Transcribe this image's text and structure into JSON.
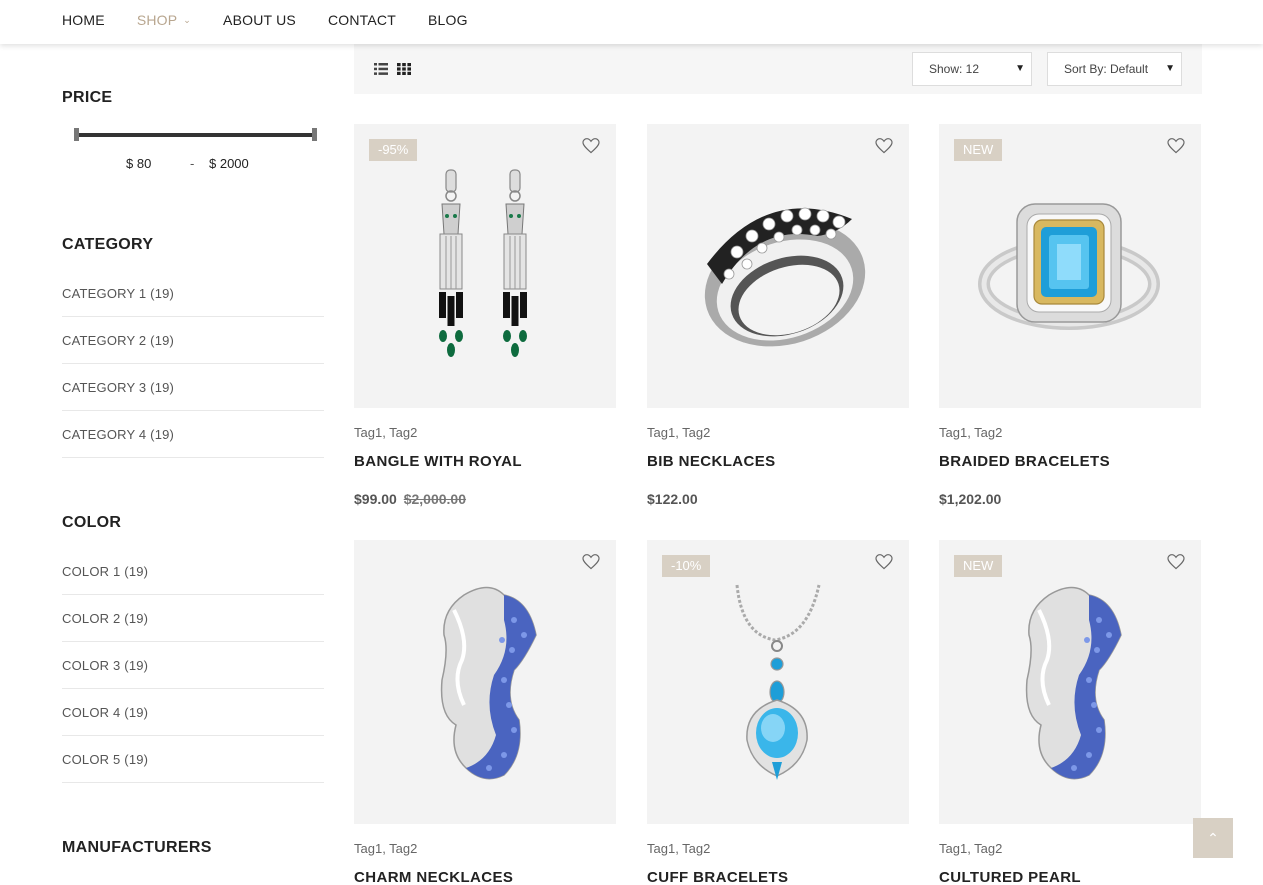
{
  "nav": {
    "items": [
      {
        "label": "HOME"
      },
      {
        "label": "SHOP"
      },
      {
        "label": "ABOUT US"
      },
      {
        "label": "CONTACT"
      },
      {
        "label": "BLOG"
      }
    ],
    "active": "SHOP",
    "accent": "#b8a68f"
  },
  "sidebar": {
    "price": {
      "title": "PRICE",
      "from": "$ 80",
      "separator": "-",
      "to": "$ 2000"
    },
    "category": {
      "title": "CATEGORY",
      "items": [
        "CATEGORY 1 (19)",
        "CATEGORY 2 (19)",
        "CATEGORY 3 (19)",
        "CATEGORY 4 (19)"
      ]
    },
    "color": {
      "title": "COLOR",
      "items": [
        "COLOR 1 (19)",
        "COLOR 2 (19)",
        "COLOR 3 (19)",
        "COLOR 4 (19)",
        "COLOR 5 (19)"
      ]
    },
    "manufacturers": {
      "title": "MANUFACTURERS"
    }
  },
  "toolbar": {
    "show": "Show: 12",
    "sort": "Sort By: Default"
  },
  "products": [
    {
      "badge": "-95%",
      "tags": "Tag1, Tag2",
      "name": "BANGLE WITH ROYAL",
      "price": "$99.00",
      "old_price": "$2,000.00",
      "image": "earrings"
    },
    {
      "badge": "",
      "tags": "Tag1, Tag2",
      "name": "BIB NECKLACES",
      "price": "$122.00",
      "old_price": "",
      "image": "ring"
    },
    {
      "badge": "NEW",
      "tags": "Tag1, Tag2",
      "name": "BRAIDED BRACELETS",
      "price": "$1,202.00",
      "old_price": "",
      "image": "topaz-ring"
    },
    {
      "badge": "",
      "tags": "Tag1, Tag2",
      "name": "CHARM NECKLACES",
      "price": "",
      "old_price": "",
      "image": "sapphire-ring"
    },
    {
      "badge": "-10%",
      "tags": "Tag1, Tag2",
      "name": "CUFF BRACELETS",
      "price": "",
      "old_price": "",
      "image": "pendant"
    },
    {
      "badge": "NEW",
      "tags": "Tag1, Tag2",
      "name": "CULTURED PEARL",
      "price": "",
      "old_price": "",
      "image": "sapphire-ring"
    }
  ],
  "colors": {
    "badge": "#d8d0c4",
    "toolbar_bg": "#f6f6f6",
    "card_bg": "#f3f3f3"
  }
}
